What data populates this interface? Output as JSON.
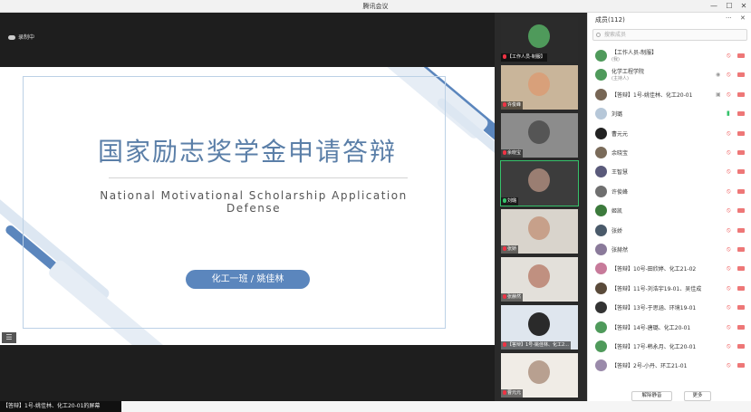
{
  "window": {
    "title": "腾讯会议",
    "controls": [
      "—",
      "☐",
      "✕"
    ]
  },
  "stage": {
    "recording_label": "录制中",
    "slide": {
      "title_cn": "国家励志奖学金申请答辩",
      "title_en": "National Motivational Scholarship Application Defense",
      "presenter": "化工一班 / 姚佳林"
    },
    "menu_glyph": "☰",
    "ticker": "【答辩】1号-姚佳林、化工20-01的屏幕"
  },
  "video_tiles": [
    {
      "label": "【工作人员-制服】",
      "mic": "muted"
    },
    {
      "label": "许俊峰",
      "mic": "muted"
    },
    {
      "label": "余晓宝",
      "mic": "muted"
    },
    {
      "label": "刘璐",
      "mic": "on"
    },
    {
      "label": "张娇",
      "mic": "muted"
    },
    {
      "label": "张赫然",
      "mic": "muted"
    },
    {
      "label": "【答辩】1号-姚佳林、化工2...",
      "mic": "muted"
    },
    {
      "label": "曹元元",
      "mic": "muted"
    }
  ],
  "participants_panel": {
    "title": "成员(112)",
    "header_icons": [
      "···",
      "✕"
    ],
    "search_placeholder": "搜索成员",
    "participants": [
      {
        "name": "【工作人员-制服】",
        "sub": "(我)",
        "mic": "muted",
        "cam": "on",
        "color": "#4f9a5b"
      },
      {
        "name": "化学工程学院",
        "sub": "(主持人)",
        "mic": "muted",
        "cam": "on",
        "color": "#4f9a5b",
        "extra": "◉"
      },
      {
        "name": "【答辩】1号-姚佳林、化工20-01",
        "sub": "",
        "mic": "muted",
        "cam": "on",
        "color": "#776655",
        "extra": "▣"
      },
      {
        "name": "刘璐",
        "sub": "",
        "mic": "on",
        "cam": "on",
        "color": "#b6c7d8"
      },
      {
        "name": "曹元元",
        "sub": "",
        "mic": "muted",
        "cam": "on",
        "color": "#222222"
      },
      {
        "name": "余晓宝",
        "sub": "",
        "mic": "muted",
        "cam": "on",
        "color": "#7a6b5a"
      },
      {
        "name": "王智慧",
        "sub": "",
        "mic": "muted",
        "cam": "on",
        "color": "#5a5a7a"
      },
      {
        "name": "许俊峰",
        "sub": "",
        "mic": "muted",
        "cam": "on",
        "color": "#6f6f6f"
      },
      {
        "name": "姬凯",
        "sub": "",
        "mic": "muted",
        "cam": "on",
        "color": "#3c7a3c"
      },
      {
        "name": "张娇",
        "sub": "",
        "mic": "muted",
        "cam": "on",
        "color": "#4a5a6a"
      },
      {
        "name": "张赫然",
        "sub": "",
        "mic": "muted",
        "cam": "on",
        "color": "#8a7a9a"
      },
      {
        "name": "【答辩】10号-田欣婷、化工21-02",
        "sub": "",
        "mic": "muted",
        "cam": "on",
        "color": "#c77a9a"
      },
      {
        "name": "【答辩】11号-刘浩宇19-01、吴佳成",
        "sub": "",
        "mic": "muted",
        "cam": "on",
        "color": "#5a4a3a"
      },
      {
        "name": "【答辩】13号-于思涵、环境19-01",
        "sub": "",
        "mic": "muted",
        "cam": "on",
        "color": "#333333"
      },
      {
        "name": "【答辩】14号-唐璐、化工20-01",
        "sub": "",
        "mic": "muted",
        "cam": "on",
        "color": "#4f9a5b"
      },
      {
        "name": "【答辩】17号-韩永月、化工20-01",
        "sub": "",
        "mic": "muted",
        "cam": "on",
        "color": "#4f9a5b"
      },
      {
        "name": "【答辩】2号-小丹、环工21-01",
        "sub": "",
        "mic": "muted",
        "cam": "on",
        "color": "#9a8aaa"
      }
    ],
    "footer_buttons": [
      "解除静音",
      "更多"
    ]
  }
}
